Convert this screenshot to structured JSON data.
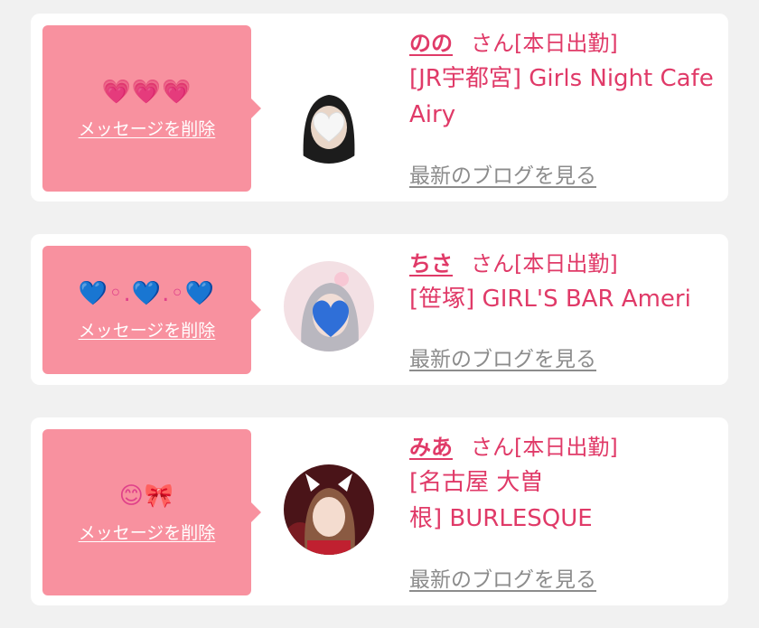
{
  "common": {
    "delete_label": "メッセージを削除",
    "san_label": "さん[本日出勤]",
    "blog_label": "最新のブログを見る"
  },
  "cards": [
    {
      "message": "💗💗💗",
      "name": "のの",
      "shop": "[JR宇都宮] Girls Night Cafe Airy"
    },
    {
      "message": "💙◦.💙.◦💙",
      "name": "ちさ",
      "shop": "[笹塚] GIRL'S BAR Ameri"
    },
    {
      "message": "😊🎀",
      "name": "みあ",
      "shop_line1": "[名古屋 大曽",
      "shop_line2": "根] BURLESQUE"
    }
  ],
  "colors": {
    "page_bg": "#f1f1f1",
    "card_bg": "#ffffff",
    "bubble_bg": "#f8919f",
    "name_color": "#e03a68",
    "blog_link": "#8c8c8c"
  }
}
